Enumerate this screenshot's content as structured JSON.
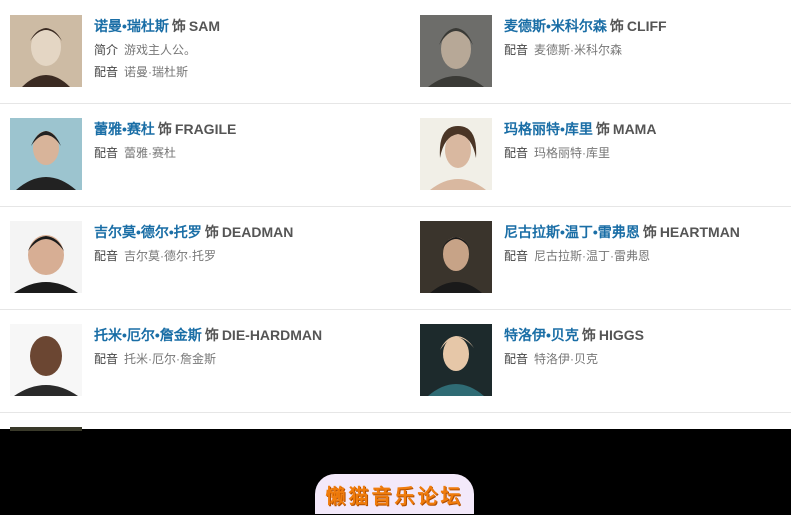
{
  "cast": [
    {
      "actor": "诺曼•瑞杜斯",
      "as": "饰",
      "role": "SAM",
      "lines": [
        {
          "k": "简介",
          "v": "游戏主人公。"
        },
        {
          "k": "配音",
          "v": "诺曼·瑞杜斯"
        }
      ],
      "photo_colors": [
        "#cdbba4",
        "#3b2b22",
        "#e4d6c4"
      ]
    },
    {
      "actor": "麦德斯•米科尔森",
      "as": "饰",
      "role": "CLIFF",
      "lines": [
        {
          "k": "配音",
          "v": "麦德斯·米科尔森"
        }
      ],
      "photo_colors": [
        "#6d6d6a",
        "#3a3a36",
        "#b7a897"
      ]
    },
    {
      "actor": "蕾雅•赛杜",
      "as": "饰",
      "role": "FRAGILE",
      "lines": [
        {
          "k": "配音",
          "v": "蕾雅·赛杜"
        }
      ],
      "photo_colors": [
        "#9cc4cf",
        "#222222",
        "#d8b49a"
      ]
    },
    {
      "actor": "玛格丽特•库里",
      "as": "饰",
      "role": "MAMA",
      "lines": [
        {
          "k": "配音",
          "v": "玛格丽特·库里"
        }
      ],
      "photo_colors": [
        "#f1efe7",
        "#4a3526",
        "#d9b8a0"
      ]
    },
    {
      "actor": "吉尔莫•德尔•托罗",
      "as": "饰",
      "role": "DEADMAN",
      "lines": [
        {
          "k": "配音",
          "v": "吉尔莫·德尔·托罗"
        }
      ],
      "photo_colors": [
        "#f4f4f4",
        "#1b1b1b",
        "#d7ae94"
      ]
    },
    {
      "actor": "尼古拉斯•温丁•雷弗恩",
      "as": "饰",
      "role": "HEARTMAN",
      "lines": [
        {
          "k": "配音",
          "v": "尼古拉斯·温丁·雷弗恩"
        }
      ],
      "photo_colors": [
        "#3a342c",
        "#1a1a1a",
        "#c7a387"
      ]
    },
    {
      "actor": "托米•厄尔•詹金斯",
      "as": "饰",
      "role": "DIE-HARDMAN",
      "lines": [
        {
          "k": "配音",
          "v": "托米·厄尔·詹金斯"
        }
      ],
      "photo_colors": [
        "#f7f7f7",
        "#2a2a2a",
        "#6b4632"
      ]
    },
    {
      "actor": "特洛伊•贝克",
      "as": "饰",
      "role": "HIGGS",
      "lines": [
        {
          "k": "配音",
          "v": "特洛伊·贝克"
        }
      ],
      "photo_colors": [
        "#1d2a2c",
        "#2f6b74",
        "#e6c7a8"
      ]
    }
  ],
  "footer": {
    "logo_text": "懒猫音乐论坛"
  }
}
